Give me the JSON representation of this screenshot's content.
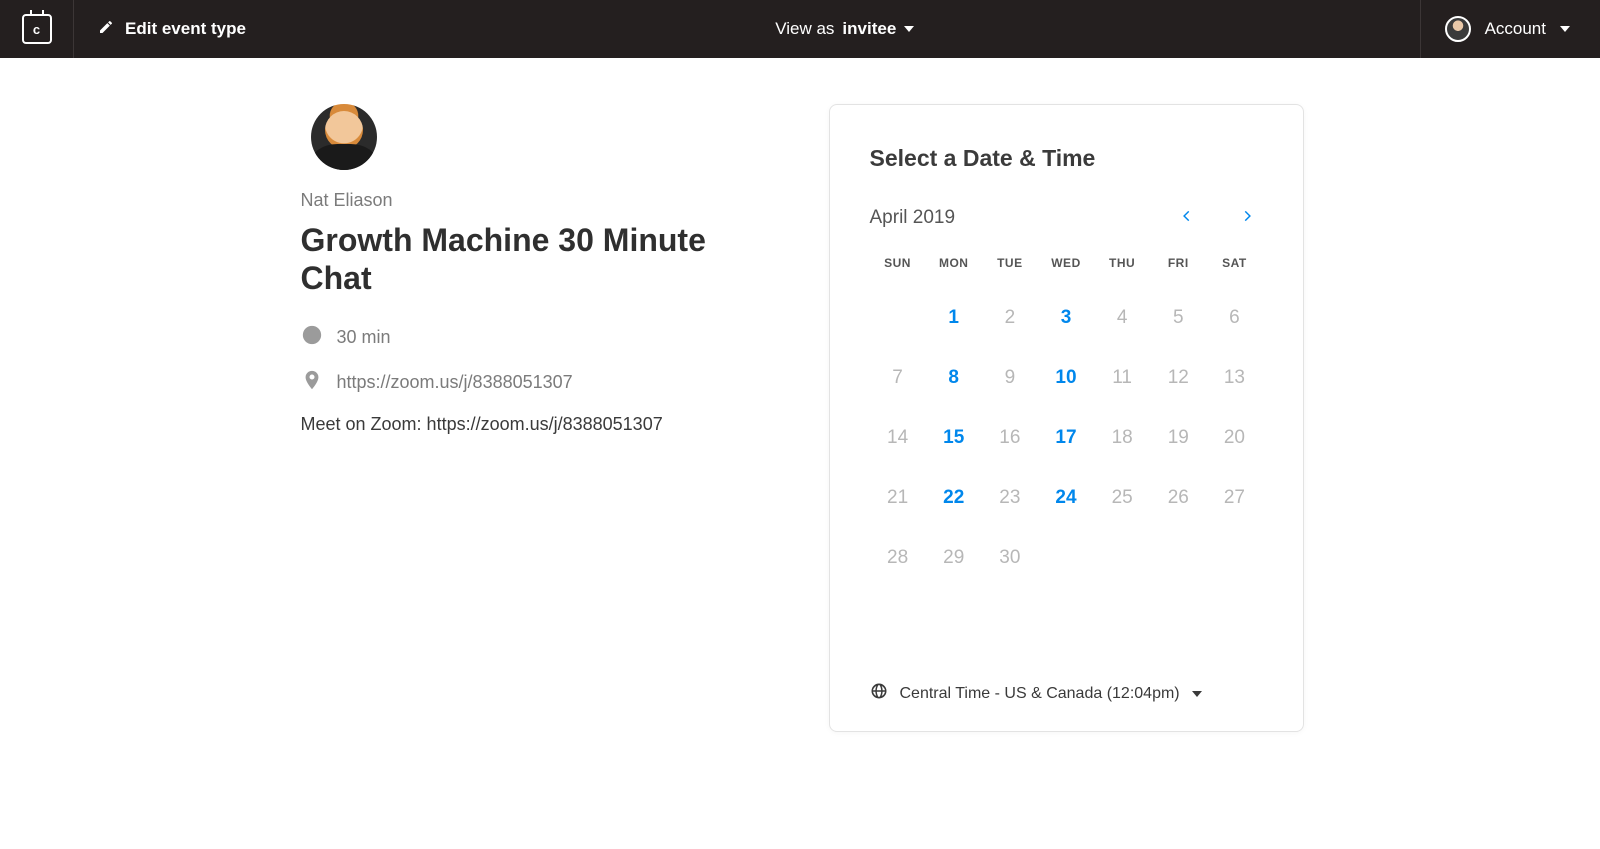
{
  "topbar": {
    "edit_label": "Edit event type",
    "view_as_prefix": "View as",
    "view_as_role": "invitee",
    "account_label": "Account"
  },
  "event": {
    "host_name": "Nat Eliason",
    "title": "Growth Machine 30 Minute Chat",
    "duration_label": "30 min",
    "location_label": "https://zoom.us/j/8388051307",
    "description": "Meet on Zoom: https://zoom.us/j/8388051307"
  },
  "picker": {
    "heading": "Select a Date & Time",
    "month_label": "April 2019",
    "weekdays": [
      "SUN",
      "MON",
      "TUE",
      "WED",
      "THU",
      "FRI",
      "SAT"
    ],
    "weeks": [
      [
        {
          "d": "",
          "a": false
        },
        {
          "d": "1",
          "a": true
        },
        {
          "d": "2",
          "a": false
        },
        {
          "d": "3",
          "a": true
        },
        {
          "d": "4",
          "a": false
        },
        {
          "d": "5",
          "a": false
        },
        {
          "d": "6",
          "a": false
        }
      ],
      [
        {
          "d": "7",
          "a": false
        },
        {
          "d": "8",
          "a": true
        },
        {
          "d": "9",
          "a": false
        },
        {
          "d": "10",
          "a": true
        },
        {
          "d": "11",
          "a": false
        },
        {
          "d": "12",
          "a": false
        },
        {
          "d": "13",
          "a": false
        }
      ],
      [
        {
          "d": "14",
          "a": false
        },
        {
          "d": "15",
          "a": true
        },
        {
          "d": "16",
          "a": false
        },
        {
          "d": "17",
          "a": true
        },
        {
          "d": "18",
          "a": false
        },
        {
          "d": "19",
          "a": false
        },
        {
          "d": "20",
          "a": false
        }
      ],
      [
        {
          "d": "21",
          "a": false
        },
        {
          "d": "22",
          "a": true
        },
        {
          "d": "23",
          "a": false
        },
        {
          "d": "24",
          "a": true
        },
        {
          "d": "25",
          "a": false
        },
        {
          "d": "26",
          "a": false
        },
        {
          "d": "27",
          "a": false
        }
      ],
      [
        {
          "d": "28",
          "a": false
        },
        {
          "d": "29",
          "a": false
        },
        {
          "d": "30",
          "a": false
        },
        {
          "d": "",
          "a": false
        },
        {
          "d": "",
          "a": false
        },
        {
          "d": "",
          "a": false
        },
        {
          "d": "",
          "a": false
        }
      ]
    ],
    "timezone_label": "Central Time - US & Canada (12:04pm)"
  }
}
